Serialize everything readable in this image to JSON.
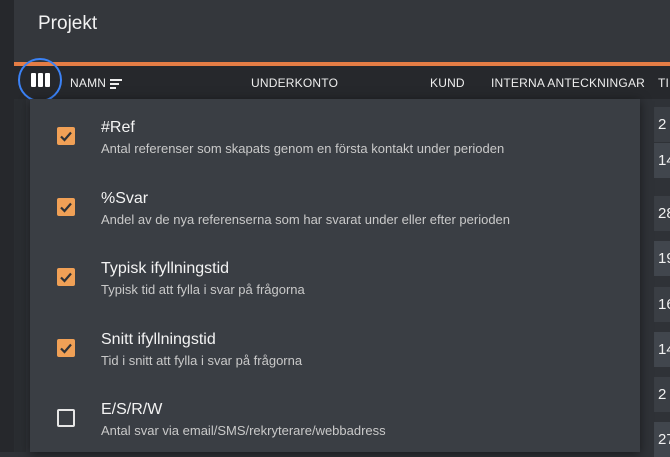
{
  "app": {
    "title": "Projekt"
  },
  "table": {
    "headers": {
      "name": "NAMN",
      "subaccount": "UNDERKONTO",
      "customer": "KUND",
      "internal_notes": "INTERNA ANTECKNINGAR",
      "partial": "TI"
    },
    "partial_column_values": [
      "2",
      "14",
      "28",
      "19",
      "16",
      "14",
      "2",
      "27"
    ]
  },
  "column_picker": {
    "items": [
      {
        "title": "#Ref",
        "description": "Antal referenser som skapats genom en första kontakt under perioden",
        "checked": true
      },
      {
        "title": "%Svar",
        "description": "Andel av de nya referenserna som har svarat under eller efter perioden",
        "checked": true
      },
      {
        "title": "Typisk ifyllningstid",
        "description": "Typisk tid att fylla i svar på frågorna",
        "checked": true
      },
      {
        "title": "Snitt ifyllningstid",
        "description": "Tid i snitt att fylla i svar på frågorna",
        "checked": true
      },
      {
        "title": "E/S/R/W",
        "description": "Antal svar via email/SMS/rekryterare/webbadress",
        "checked": false
      }
    ]
  },
  "colors": {
    "accent": "#e57d45",
    "checkbox": "#f0a056",
    "focus_ring": "#3b82f6"
  }
}
